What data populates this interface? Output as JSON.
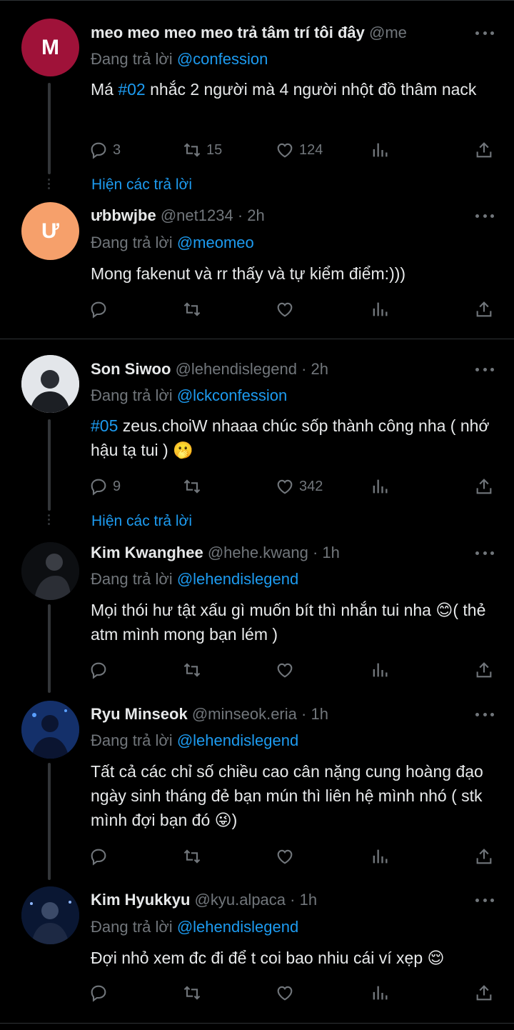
{
  "tweets": [
    {
      "name": "meo meo meo meo trả tâm trí tôi đây",
      "handle": "@me",
      "time": "",
      "avatar_letter": "M",
      "avatar_color": "#9f1239",
      "reply_label": "Đang trả lời",
      "reply_to": "@confession",
      "text_tag": "#02",
      "text": "Má #02 nhắc 2 người mà 4 người nhột đồ thâm nack",
      "replies": "3",
      "retweets": "15",
      "likes": "124"
    },
    {
      "name": "ưbbwjbe",
      "handle": "@net1234",
      "time": "· 2h",
      "avatar_letter": "Ư",
      "avatar_color": "#f6a06b",
      "reply_label": "Đang trả lời",
      "reply_to": "@meomeo",
      "text": "Mong fakenut và rr thấy và tự kiểm điểm:)))",
      "replies": "",
      "retweets": "",
      "likes": ""
    },
    {
      "name": "Son Siwoo",
      "handle": "@lehendislegend",
      "time": "· 2h",
      "avatar_color": "#d9dde2",
      "reply_label": "Đang trả lời",
      "reply_to": "@lckconfession",
      "text_tag": "#05",
      "text": "#05 zeus.choiW nhaaa chúc sốp thành công nha ( nhớ hậu tạ tui ) 🫢",
      "replies": "9",
      "retweets": "",
      "likes": "342"
    },
    {
      "name": "Kim Kwanghee",
      "handle": "@hehe.kwang",
      "time": "· 1h",
      "avatar_color": "#111317",
      "reply_label": "Đang trả lời",
      "reply_to": "@lehendislegend",
      "text": "Mọi thói hư tật xấu gì muốn bít thì nhắn tui nha 😊( thẻ atm mình mong bạn lém )",
      "replies": "",
      "retweets": "",
      "likes": ""
    },
    {
      "name": "Ryu Minseok",
      "handle": "@minseok.eria",
      "time": "· 1h",
      "avatar_color": "#13284f",
      "reply_label": "Đang trả lời",
      "reply_to": "@lehendislegend",
      "text": "Tất cả các chỉ số chiều cao cân nặng cung hoàng đạo ngày sinh tháng đẻ bạn mún thì liên hệ mình nhó ( stk mình đợi bạn đó 😜)",
      "replies": "",
      "retweets": "",
      "likes": ""
    },
    {
      "name": "Kim Hyukkyu",
      "handle": "@kyu.alpaca",
      "time": "· 1h",
      "avatar_color": "#0b1a35",
      "reply_label": "Đang trả lời",
      "reply_to": "@lehendislegend",
      "text": "Đợi nhỏ xem đc đi để t coi bao nhiu cái ví xẹp 😌",
      "replies": "",
      "retweets": "",
      "likes": ""
    }
  ],
  "show_replies_label": "Hiện các trả lời",
  "colors": {
    "accent": "#1d9bf0",
    "muted": "#71767b",
    "text": "#e7e9ea",
    "background": "#000000"
  },
  "icons": [
    "reply-icon",
    "retweet-icon",
    "like-icon",
    "views-icon",
    "share-icon",
    "more-icon"
  ]
}
